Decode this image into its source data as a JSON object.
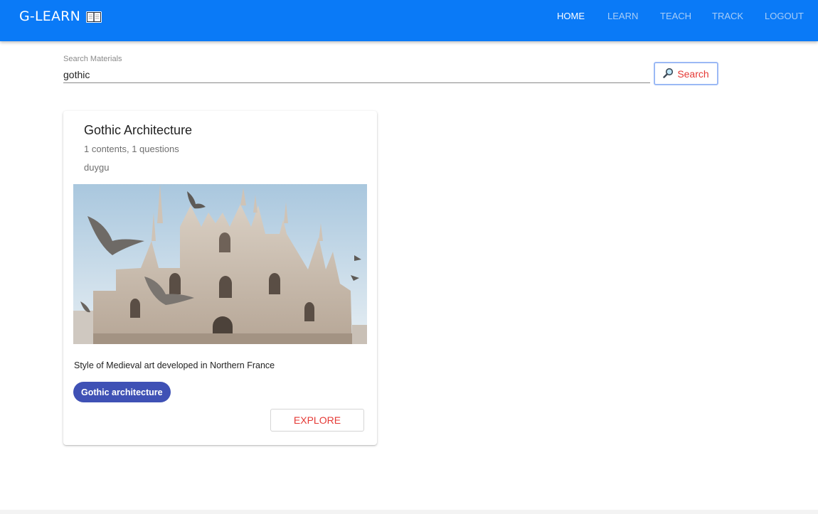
{
  "app": {
    "brand": "G-LEARN",
    "brand_icon": "open-book-icon",
    "colors": {
      "appbar": "#0a7af7",
      "accent": "#e53935",
      "chip": "#3f51b5"
    }
  },
  "nav": {
    "items": [
      {
        "label": "HOME",
        "active": true
      },
      {
        "label": "LEARN",
        "active": false
      },
      {
        "label": "TEACH",
        "active": false
      },
      {
        "label": "TRACK",
        "active": false
      },
      {
        "label": "LOGOUT",
        "active": false
      }
    ]
  },
  "search": {
    "label": "Search Materials",
    "value": "gothic",
    "button_label": "Search",
    "button_icon": "magnifier-icon"
  },
  "results": [
    {
      "title": "Gothic Architecture",
      "meta": "1 contents, 1 questions",
      "author": "duygu",
      "image_description": "gothic-cathedral-photo",
      "description": "Style of Medieval art developed in Northern France",
      "tag": "Gothic architecture",
      "action_label": "EXPLORE"
    }
  ]
}
